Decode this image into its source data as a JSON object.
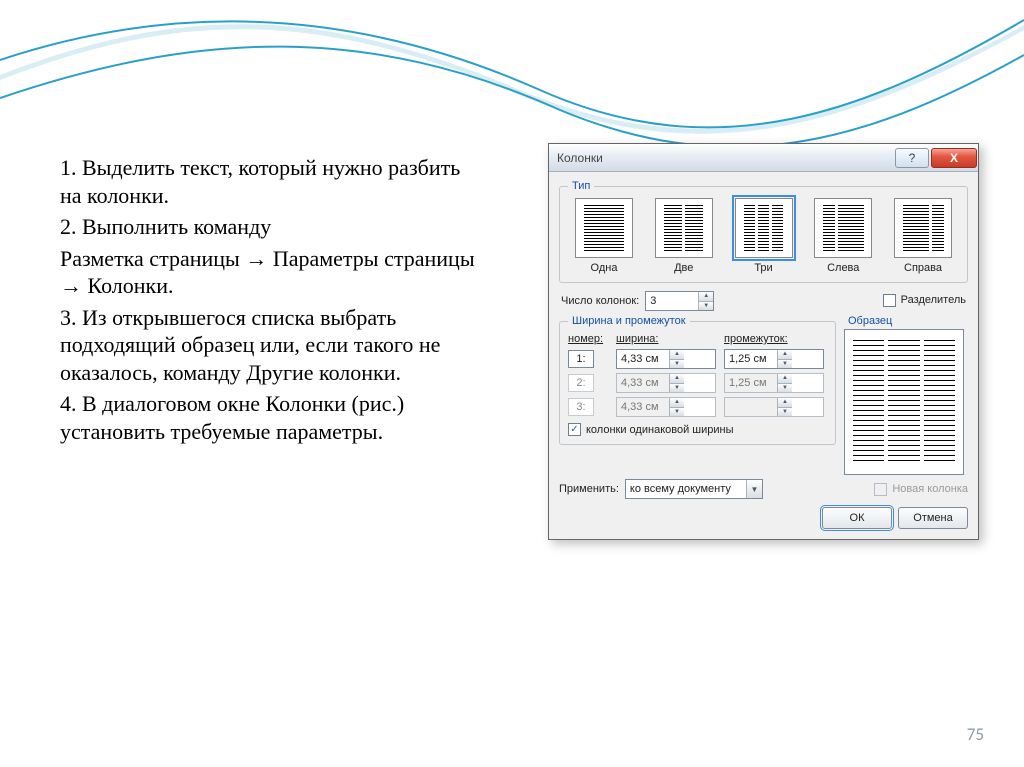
{
  "page_number": "75",
  "instructions": {
    "p1": "1. Выделить текст, который нужно разбить на колонки.",
    "p2": "2. Выполнить команду",
    "p3": "Разметка страницы → Параметры страницы → Колонки.",
    "p4": "3. Из открывшегося списка выбрать подходящий образец или, если такого не оказалось, команду Другие колонки.",
    "p5": "4. В диалоговом окне Колонки (рис.) установить требуемые параметры."
  },
  "dialog": {
    "title": "Колонки",
    "help_glyph": "?",
    "close_glyph": "X",
    "type_group": "Тип",
    "types": {
      "one": "Одна",
      "two": "Две",
      "three": "Три",
      "left": "Слева",
      "right": "Справа"
    },
    "num_cols_label": "Число колонок:",
    "num_cols_value": "3",
    "divider_label": "Разделитель",
    "width_group": "Ширина и промежуток",
    "headers": {
      "num": "номер:",
      "width": "ширина:",
      "gap": "промежуток:"
    },
    "rows": [
      {
        "idx": "1:",
        "width": "4,33 см",
        "gap": "1,25 см",
        "enabled": true
      },
      {
        "idx": "2:",
        "width": "4,33 см",
        "gap": "1,25 см",
        "enabled": false
      },
      {
        "idx": "3:",
        "width": "4,33 см",
        "gap": "",
        "enabled": false
      }
    ],
    "equal_width_label": "колонки одинаковой ширины",
    "sample_label": "Образец",
    "apply_label": "Применить:",
    "apply_value": "ко всему документу",
    "new_col_label": "Новая колонка",
    "ok": "ОК",
    "cancel": "Отмена"
  }
}
